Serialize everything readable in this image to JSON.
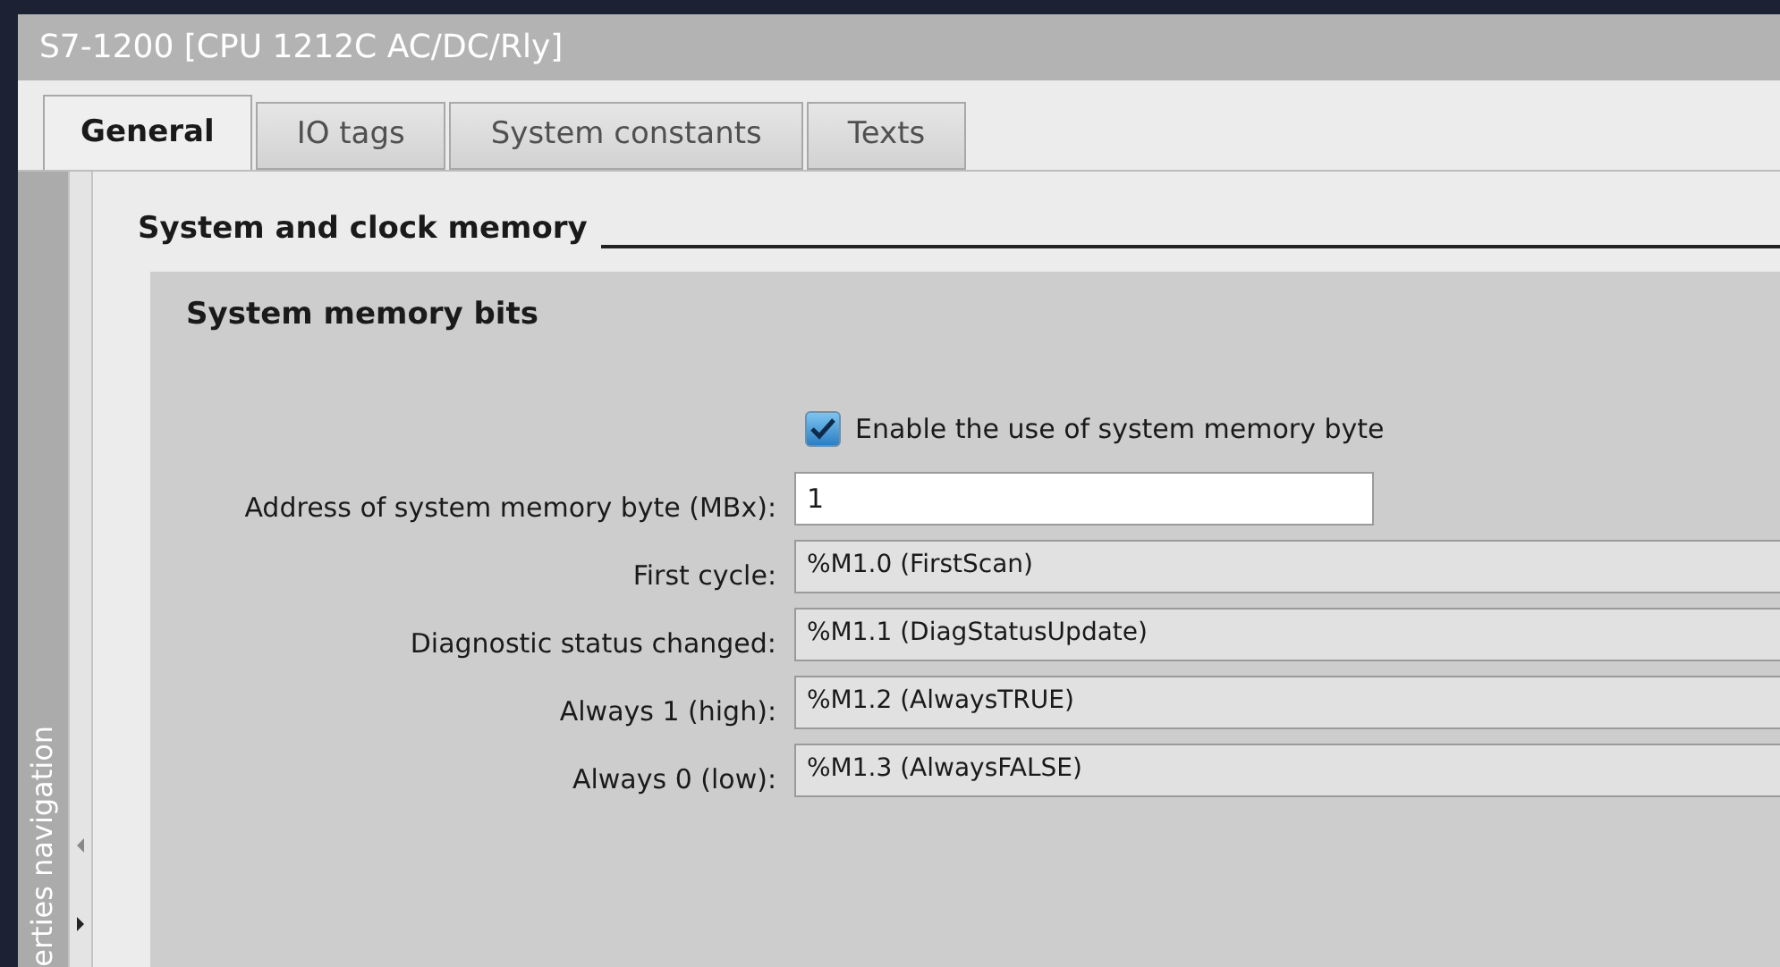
{
  "window": {
    "title": "S7-1200 [CPU 1212C AC/DC/Rly]"
  },
  "tabs": [
    {
      "label": "General",
      "selected": true
    },
    {
      "label": "IO tags",
      "selected": false
    },
    {
      "label": "System constants",
      "selected": false
    },
    {
      "label": "Texts",
      "selected": false
    }
  ],
  "side_navigation": {
    "label": "erties navigation"
  },
  "section": {
    "title": "System and clock memory"
  },
  "group": {
    "title": "System memory bits",
    "enable_checkbox": {
      "label": "Enable the use of system memory byte",
      "checked": true
    },
    "fields": [
      {
        "kind": "input",
        "label": "Address of system memory byte (MBx):",
        "value": "1"
      },
      {
        "kind": "readonly",
        "label": "First cycle:",
        "value": "%M1.0 (FirstScan)"
      },
      {
        "kind": "readonly",
        "label": "Diagnostic status changed:",
        "value": "%M1.1 (DiagStatusUpdate)"
      },
      {
        "kind": "readonly",
        "label": "Always 1 (high):",
        "value": "%M1.2 (AlwaysTRUE)"
      },
      {
        "kind": "readonly",
        "label": "Always 0 (low):",
        "value": "%M1.3 (AlwaysFALSE)"
      }
    ]
  }
}
